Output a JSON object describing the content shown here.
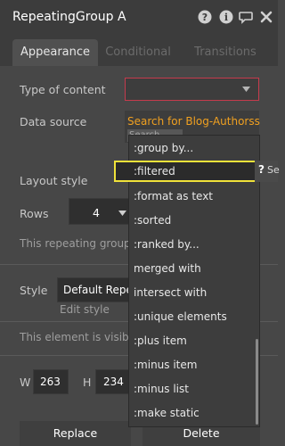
{
  "window": {
    "title": "RepeatingGroup A",
    "icons": [
      "help-icon",
      "info-icon",
      "comment-icon",
      "close-icon"
    ]
  },
  "tabs": [
    {
      "label": "Appearance",
      "active": true
    },
    {
      "label": "Conditional",
      "active": false
    },
    {
      "label": "Transitions",
      "active": false
    }
  ],
  "fields": {
    "type_of_content_label": "Type of content",
    "data_source_label": "Data source",
    "data_source_value": "Search for Blog-Authorss",
    "search_placeholder": "Search...",
    "layout_style_label": "Layout style",
    "rows_label": "Rows",
    "rows_value": "4",
    "info_text": "This repeating group has",
    "style_label": "Style",
    "style_value": "Default Repeat",
    "edit_style_link": "Edit style",
    "visible_text": "This element is visible o",
    "w_label": "W",
    "w_value": "263",
    "h_label": "H",
    "h_value": "234"
  },
  "dropdown": {
    "items": [
      ":group by...",
      ":filtered",
      ":format as text",
      ":sorted",
      ":ranked by...",
      " merged with",
      " intersect with",
      ":unique elements",
      ":plus item",
      ":minus item",
      ":minus list",
      ":make static"
    ],
    "highlighted_index": 1,
    "hint_partial": "Se"
  },
  "buttons": {
    "replace": "Replace",
    "delete": "Delete"
  },
  "colors": {
    "accent_orange": "#f0a020",
    "highlight_yellow": "#f0e23a",
    "error_red": "#c53b4d"
  }
}
